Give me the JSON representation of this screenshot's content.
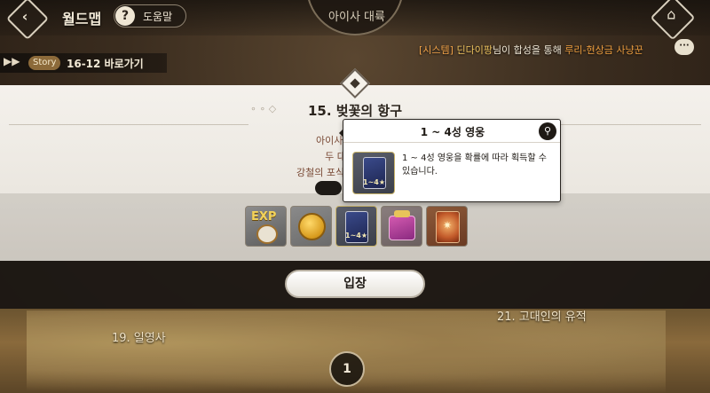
{
  "header": {
    "back_icon": "back-diamond-icon",
    "title": "월드맵",
    "help_icon_glyph": "?",
    "help_label": "도움말",
    "region_name": "아이사 대륙",
    "home_icon": "home-icon"
  },
  "system_message": {
    "prefix": "[시스템]",
    "user": "딘다이팡",
    "middle": "님이 합성을 통해",
    "item": "루리-현상금 사냥꾼"
  },
  "story": {
    "tag": "Story",
    "label": "16-12 바로가기"
  },
  "map": {
    "label_left": "19. 일영사",
    "label_right": "21. 고대인의 유적",
    "page_number": "1"
  },
  "stage": {
    "title": "15. 벚꽃의 항구",
    "description_lines": [
      "아이사와 아스드 대",
      "두 대륙 사이는",
      "강철의 포식자와 같은 해룡도"
    ]
  },
  "rewards": [
    {
      "name": "exp-reward",
      "badge": "EXP"
    },
    {
      "name": "gold-reward"
    },
    {
      "name": "hero-reward",
      "badge": "1~4★"
    },
    {
      "name": "gift-box-reward"
    },
    {
      "name": "card-reward"
    }
  ],
  "tooltip": {
    "title": "1 ~ 4성 영웅",
    "description": "1 ~ 4성 영웅을 확률에 따라 획득할 수 있습니다.",
    "icon_badge": "1~4★"
  },
  "enter_button": "입장",
  "colors": {
    "accent_orange": "#f3a44a",
    "desc_text": "#7a4a36",
    "panel_bg": "#f4f1ec"
  }
}
